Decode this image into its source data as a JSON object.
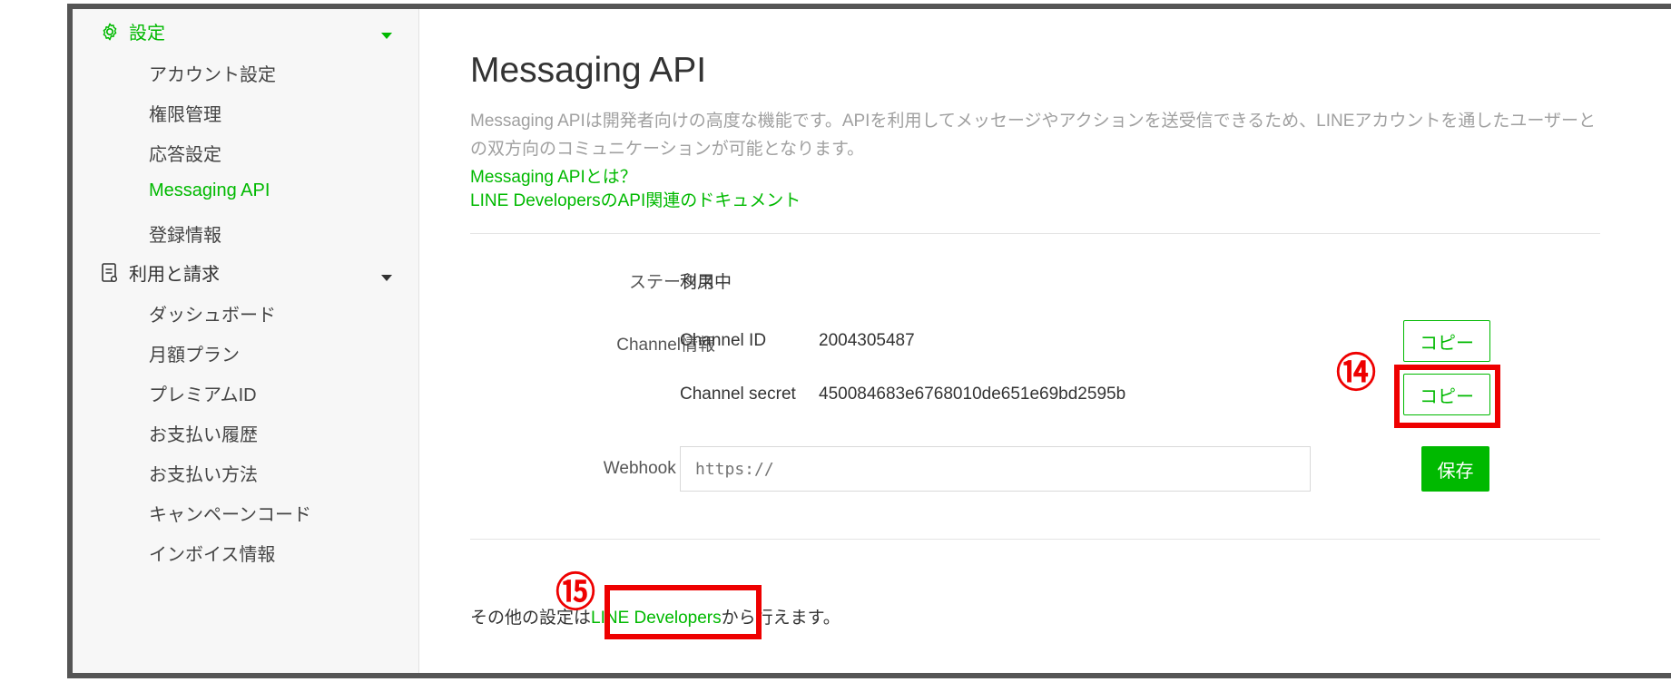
{
  "sidebar": {
    "settings_label": "設定",
    "settings_items": [
      "アカウント設定",
      "権限管理",
      "応答設定",
      "Messaging API",
      "登録情報"
    ],
    "billing_label": "利用と請求",
    "billing_items": [
      "ダッシュボード",
      "月額プラン",
      "プレミアムID",
      "お支払い履歴",
      "お支払い方法",
      "キャンペーンコード",
      "インボイス情報"
    ]
  },
  "main": {
    "title": "Messaging API",
    "description": "Messaging APIは開発者向けの高度な機能です。APIを利用してメッセージやアクションを送受信できるため、LINEアカウントを通したユーザーとの双方向のコミュニケーションが可能となります。",
    "link_about": "Messaging APIとは？",
    "link_docs": "LINE DevelopersのAPI関連のドキュメント",
    "status_label": "ステータス",
    "status_value": "利用中",
    "channel_label": "Channel情報",
    "channel_id_label": "Channel ID",
    "channel_id_value": "2004305487",
    "channel_secret_label": "Channel secret",
    "channel_secret_value": "450084683e6768010de651e69bd2595b",
    "copy_label": "コピー",
    "webhook_label": "Webhook URL",
    "webhook_placeholder": "https://",
    "save_label": "保存",
    "footer_before": "その他の設定は",
    "footer_link": "LINE Developers",
    "footer_after": "から行えます。"
  },
  "annotations": {
    "step14": "⑭",
    "step15": "⑮"
  },
  "colors": {
    "accent": "#00b900",
    "highlight": "#ee0000",
    "frame": "#555555"
  },
  "icons": {
    "settings": "gear-icon",
    "billing": "document-icon"
  }
}
